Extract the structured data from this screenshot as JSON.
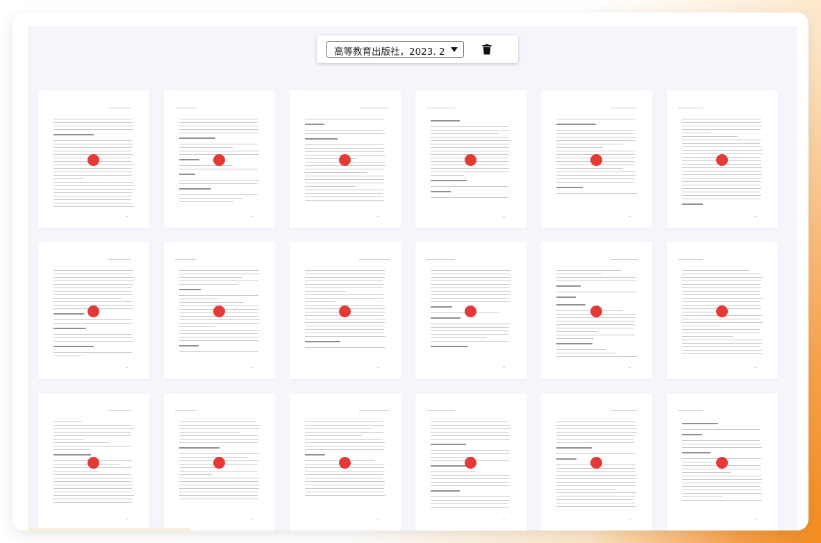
{
  "toolbar": {
    "source_select_value": "高等教育出版社，2023. 2.…",
    "delete_icon": "trash-icon"
  },
  "pages": [
    {
      "index": 1,
      "marker": "red-dot"
    },
    {
      "index": 2,
      "marker": "red-dot"
    },
    {
      "index": 3,
      "marker": "red-dot"
    },
    {
      "index": 4,
      "marker": "red-dot"
    },
    {
      "index": 5,
      "marker": "red-dot"
    },
    {
      "index": 6,
      "marker": "red-dot"
    },
    {
      "index": 7,
      "marker": "red-dot"
    },
    {
      "index": 8,
      "marker": "red-dot"
    },
    {
      "index": 9,
      "marker": "red-dot"
    },
    {
      "index": 10,
      "marker": "red-dot"
    },
    {
      "index": 11,
      "marker": "red-dot"
    },
    {
      "index": 12,
      "marker": "red-dot"
    },
    {
      "index": 13,
      "marker": "red-dot"
    },
    {
      "index": 14,
      "marker": "red-dot"
    },
    {
      "index": 15,
      "marker": "red-dot"
    },
    {
      "index": 16,
      "marker": "red-dot"
    },
    {
      "index": 17,
      "marker": "red-dot"
    },
    {
      "index": 18,
      "marker": "red-dot"
    }
  ],
  "colors": {
    "marker": "#e53935",
    "canvas": "#f4f6fb",
    "accent_gradient": "#f48c1e"
  }
}
